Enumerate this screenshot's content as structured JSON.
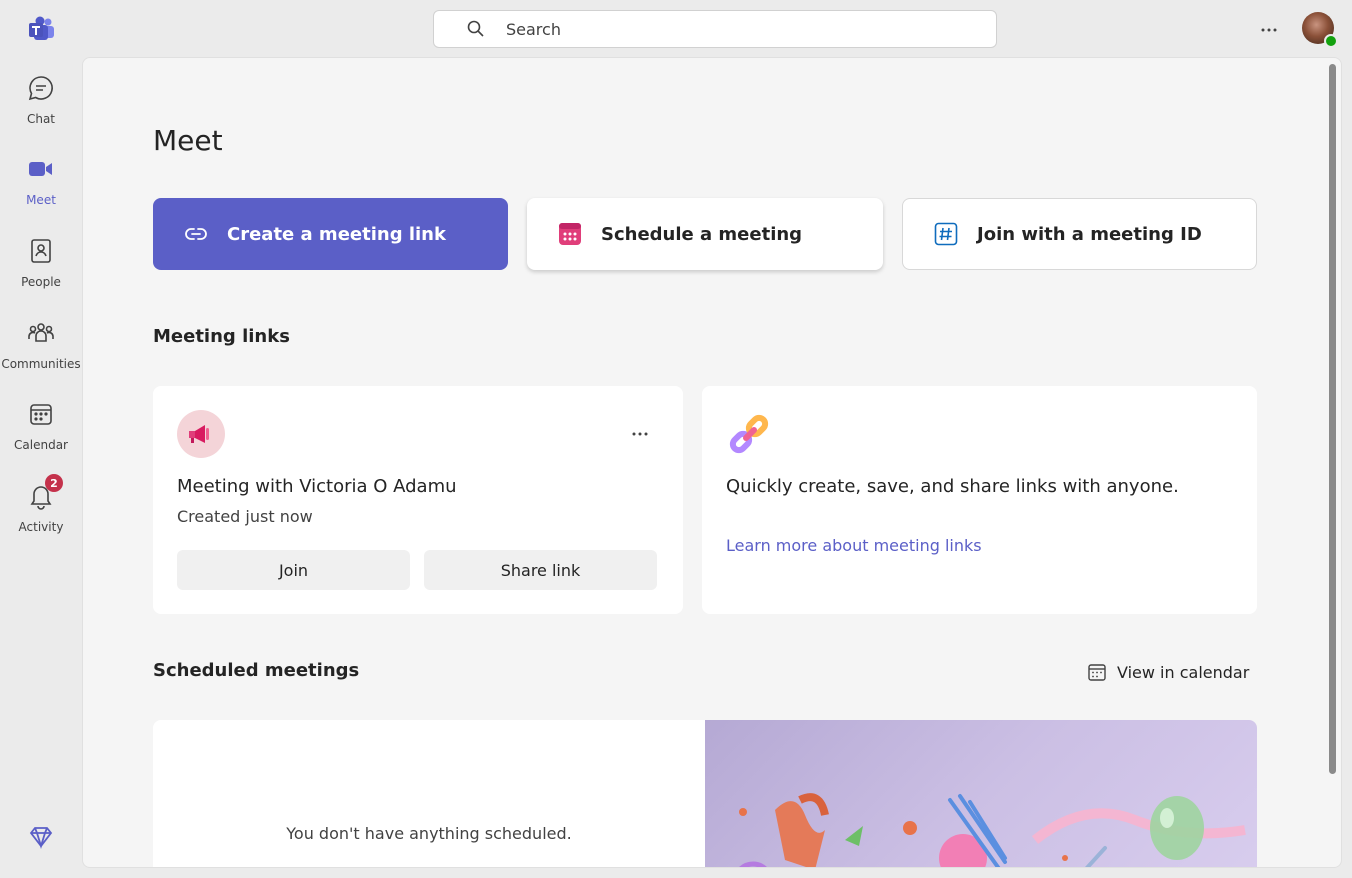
{
  "rail": {
    "items": [
      {
        "label": "Chat",
        "icon": "chat-icon"
      },
      {
        "label": "Meet",
        "icon": "video-camera-icon",
        "active": true
      },
      {
        "label": "People",
        "icon": "people-icon"
      },
      {
        "label": "Communities",
        "icon": "communities-icon"
      },
      {
        "label": "Calendar",
        "icon": "calendar-icon"
      },
      {
        "label": "Activity",
        "icon": "bell-icon",
        "badge": "2"
      }
    ]
  },
  "search": {
    "placeholder": "Search"
  },
  "page": {
    "title": "Meet"
  },
  "actions": {
    "create": "Create a meeting link",
    "schedule": "Schedule a meeting",
    "join": "Join with a meeting ID"
  },
  "meeting_links": {
    "heading": "Meeting links",
    "card": {
      "title": "Meeting with Victoria O Adamu",
      "subtitle": "Created just now",
      "join_label": "Join",
      "share_label": "Share link"
    },
    "info": {
      "text": "Quickly create, save, and share links with anyone.",
      "link": "Learn more about meeting links"
    }
  },
  "scheduled": {
    "heading": "Scheduled meetings",
    "view_calendar": "View in calendar",
    "empty_text": "You don't have anything scheduled."
  },
  "colors": {
    "accent": "#5b5fc7",
    "badge": "#c4314b",
    "presence": "#13a10e",
    "schedule_icon": "#e03e7a",
    "join_icon": "#0f6cbd"
  }
}
